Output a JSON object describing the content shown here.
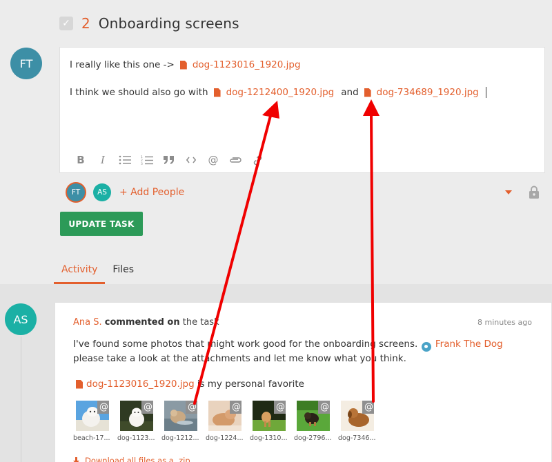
{
  "task": {
    "number": "2",
    "title": "Onboarding screens"
  },
  "editor": {
    "author_initials": "FT",
    "line1_text": "I really like this one ->",
    "line1_file": "dog-1123016_1920.jpg",
    "line2_text": "I think we should also go with",
    "line2_file_a": "dog-1212400_1920.jpg",
    "line2_and": "and",
    "line2_file_b": "dog-734689_1920.jpg",
    "toolbar": [
      "bold-icon",
      "italic-icon",
      "bullet-list-icon",
      "numbered-list-icon",
      "quote-icon",
      "code-icon",
      "mention-icon",
      "attachment-icon",
      "link-icon"
    ]
  },
  "people": {
    "members": [
      "FT",
      "AS"
    ],
    "add_label": "+ Add People"
  },
  "actions": {
    "update_label": "UPDATE TASK"
  },
  "tabs": [
    {
      "label": "Activity",
      "active": true
    },
    {
      "label": "Files",
      "active": false
    }
  ],
  "activity": {
    "avatar_initials": "AS",
    "author": "Ana S.",
    "verb": "commented on",
    "target": "the task",
    "time": "8 minutes ago",
    "body_before": "I've found some photos that might work good for the onboarding screens.",
    "mention": "Frank The Dog",
    "body_after": "please take a look at the attachments and let me know what you think.",
    "favorite_file": "dog-1123016_1920.jpg",
    "favorite_suffix": "is my personal favorite",
    "attachments": [
      {
        "label": "beach-17..."
      },
      {
        "label": "dog-1123..."
      },
      {
        "label": "dog-1212..."
      },
      {
        "label": "dog-1224..."
      },
      {
        "label": "dog-1310..."
      },
      {
        "label": "dog-2796..."
      },
      {
        "label": "dog-7346..."
      }
    ],
    "attachment_badge": "@",
    "download_label": "Download all files as a .zip"
  },
  "colors": {
    "accent": "#e35f2d",
    "button_green": "#2c9a58",
    "annotation_arrow": "#f00000"
  }
}
